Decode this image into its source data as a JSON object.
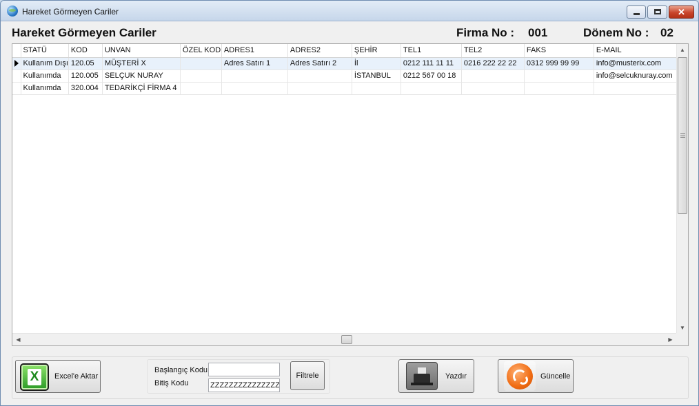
{
  "window": {
    "title": "Hareket Görmeyen Cariler"
  },
  "header": {
    "title": "Hareket Görmeyen Cariler",
    "firma_label": "Firma No :",
    "firma_value": "001",
    "donem_label": "Dönem No :",
    "donem_value": "02"
  },
  "grid": {
    "columns": [
      "STATÜ",
      "KOD",
      "UNVAN",
      "ÖZEL KOD",
      "ADRES1",
      "ADRES2",
      "ŞEHİR",
      "TEL1",
      "TEL2",
      "FAKS",
      "E-MAIL"
    ],
    "rows": [
      [
        "Kullanım Dışı",
        "120.05",
        "MÜŞTERİ X",
        "",
        "Adres Satırı 1",
        "Adres Satırı 2",
        "İl",
        "0212 111 11 11",
        "0216 222 22 22",
        "0312 999 99 99",
        "info@musterix.com"
      ],
      [
        "Kullanımda",
        "120.005",
        "SELÇUK NURAY",
        "",
        "",
        "",
        "İSTANBUL",
        "0212 567 00 18",
        "",
        "",
        "info@selcuknuray.com"
      ],
      [
        "Kullanımda",
        "320.004",
        "TEDARİKÇİ FİRMA 4",
        "",
        "",
        "",
        "",
        "",
        "",
        "",
        ""
      ]
    ]
  },
  "toolbar": {
    "excel_label": "Excel'e Aktar",
    "baslangic_label": "Başlangıç Kodu",
    "baslangic_value": "",
    "bitis_label": "Bitiş Kodu",
    "bitis_value": "ZZZZZZZZZZZZZZZZ",
    "filtrele_label": "Filtrele",
    "yazdir_label": "Yazdır",
    "guncelle_label": "Güncelle"
  },
  "icons": {
    "app": "globe-icon",
    "excel": "excel-icon",
    "printer": "printer-icon",
    "refresh": "refresh-icon"
  },
  "colors": {
    "titlebar": "#c6d6ea",
    "selected_row": "#e8f1fb",
    "close_button": "#c9452b",
    "excel_green": "#2a9a25",
    "refresh_orange": "#f06b12"
  }
}
